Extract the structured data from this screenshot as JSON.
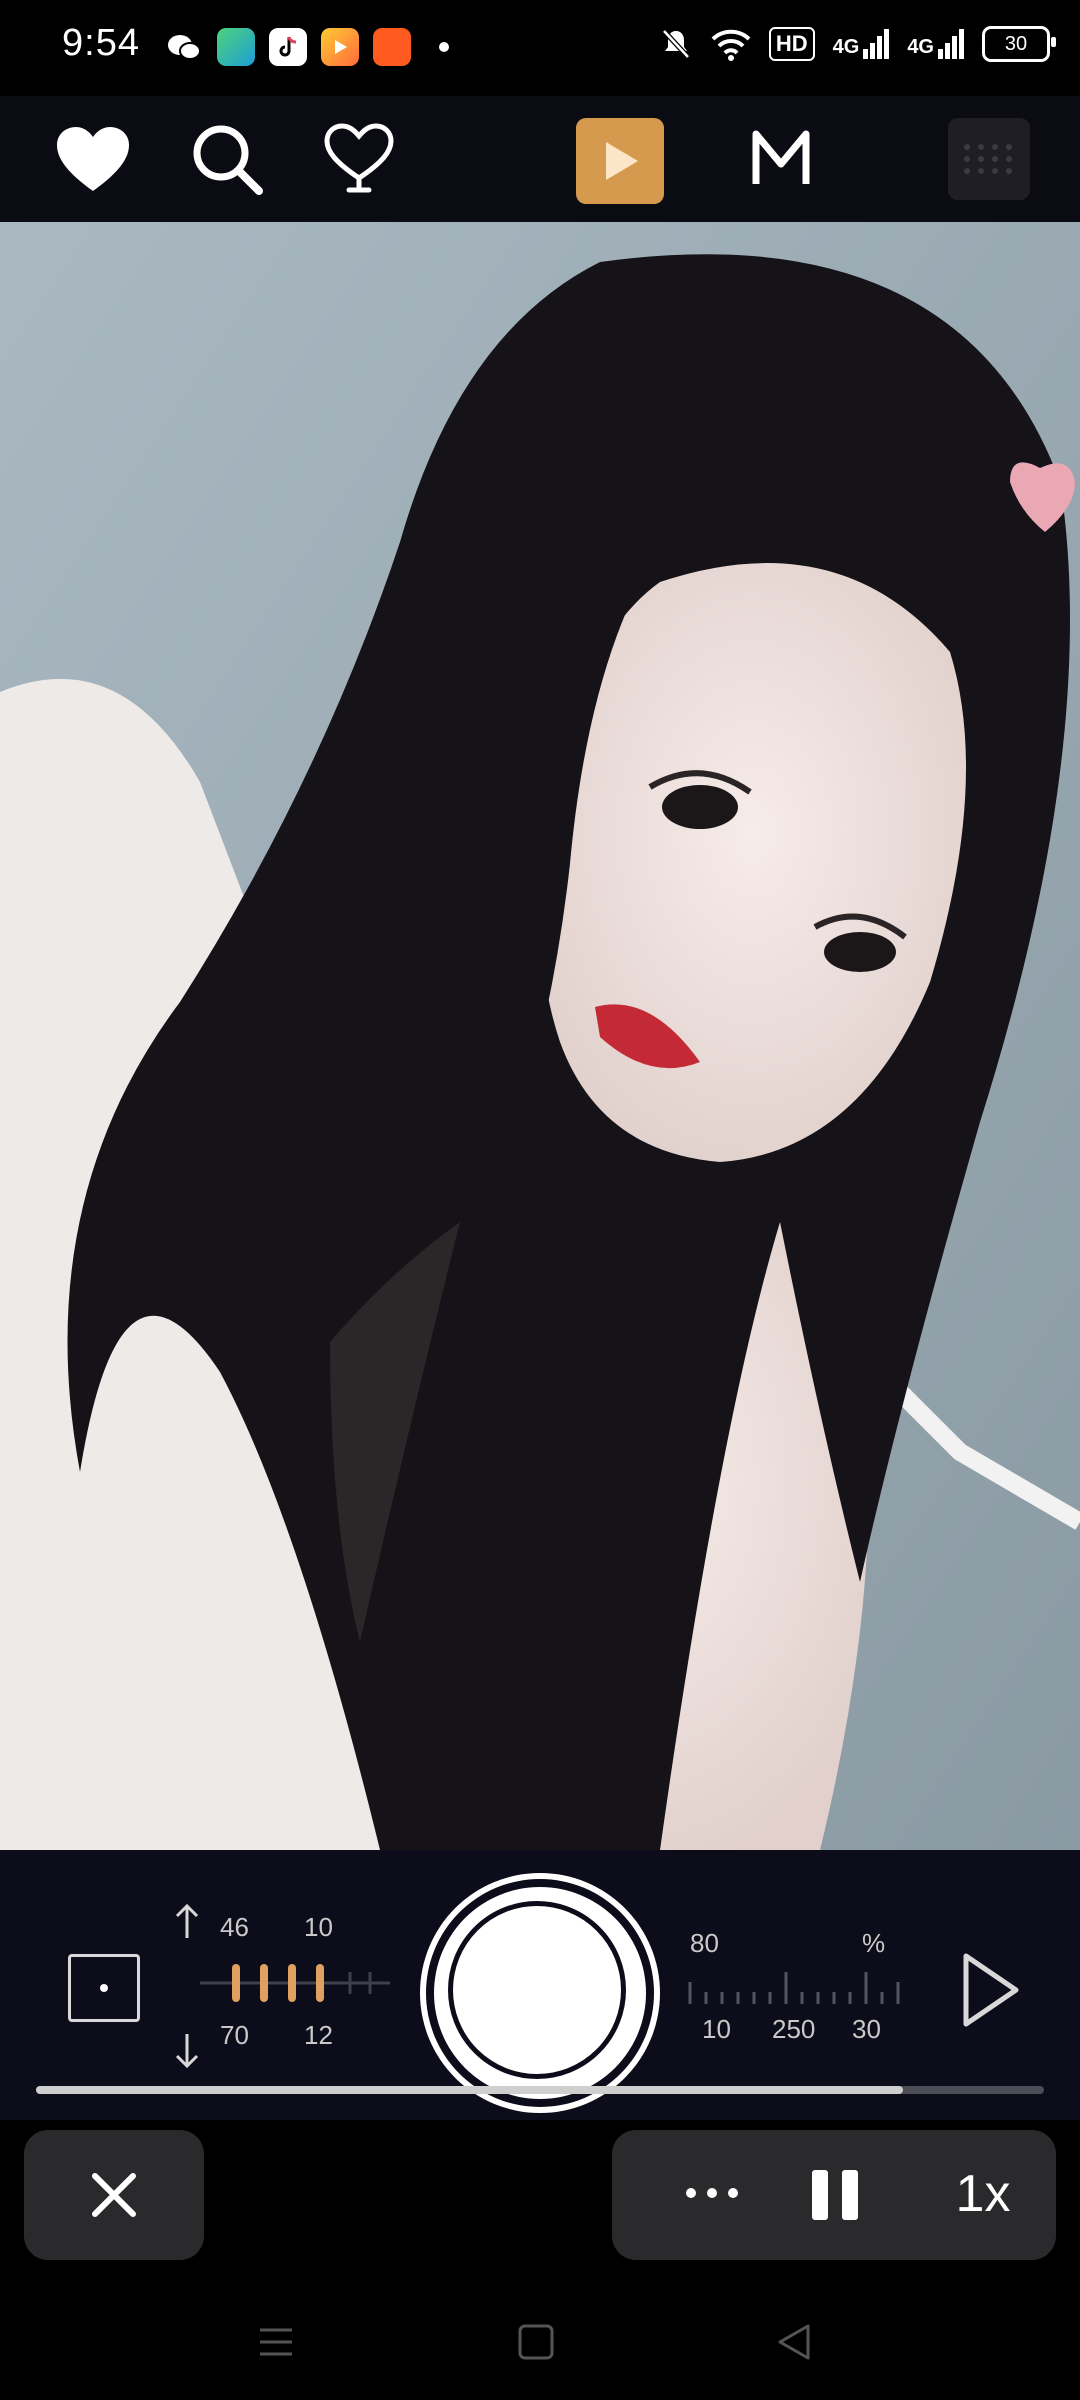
{
  "status_bar": {
    "time": "9:54",
    "hd": "HD",
    "net1": "4G",
    "net2": "4G",
    "battery": "30"
  },
  "toolbar": {
    "accent": "#d59a4e",
    "icons": [
      "heart-filled-icon",
      "search-icon",
      "heart-outline-icon",
      "play-icon",
      "m-logo-icon",
      "grid-icon"
    ]
  },
  "dial": {
    "left_top": [
      "46",
      "10"
    ],
    "left_bottom": [
      "70",
      "12"
    ],
    "right_top": [
      "80",
      "%"
    ],
    "right_bottom": [
      "10",
      "250",
      "30"
    ]
  },
  "progress": {
    "value_percent": 86
  },
  "player": {
    "speed_label": "1x"
  }
}
